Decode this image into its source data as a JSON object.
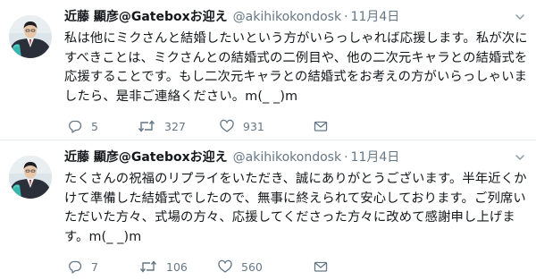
{
  "tweets": [
    {
      "author_name": "近藤 顯彦@Gateboxお迎え",
      "handle": "@akihikokondosk",
      "separator": "·",
      "date": "11月4日",
      "text": "私は他にミクさんと結婚したいという方がいらっしゃれば応援します。私が次にすべきことは、ミクさんとの結婚式の二例目や、他の二次元キャラとの結婚式を応援することです。もし二次元キャラとの結婚式をお考えの方がいらっしゃいましたら、是非ご連絡ください。m(_ _)m",
      "replies": "5",
      "retweets": "327",
      "likes": "931"
    },
    {
      "author_name": "近藤 顯彦@Gateboxお迎え",
      "handle": "@akihikokondosk",
      "separator": "·",
      "date": "11月4日",
      "text": "たくさんの祝福のリプライをいただき、誠にありがとうございます。半年近くかけて準備した結婚式でしたので、無事に終えられて安心しております。ご列席いただいた方々、式場の方々、応援してくださった方々に改めて感謝申し上げます。m(_ _)m",
      "replies": "7",
      "retweets": "106",
      "likes": "560"
    }
  ],
  "colors": {
    "text_primary": "#14171a",
    "text_secondary": "#657786",
    "divider": "#e6ecf0"
  },
  "icons": [
    "reply-icon",
    "retweet-icon",
    "like-icon",
    "direct-message-icon",
    "chevron-down-icon"
  ]
}
